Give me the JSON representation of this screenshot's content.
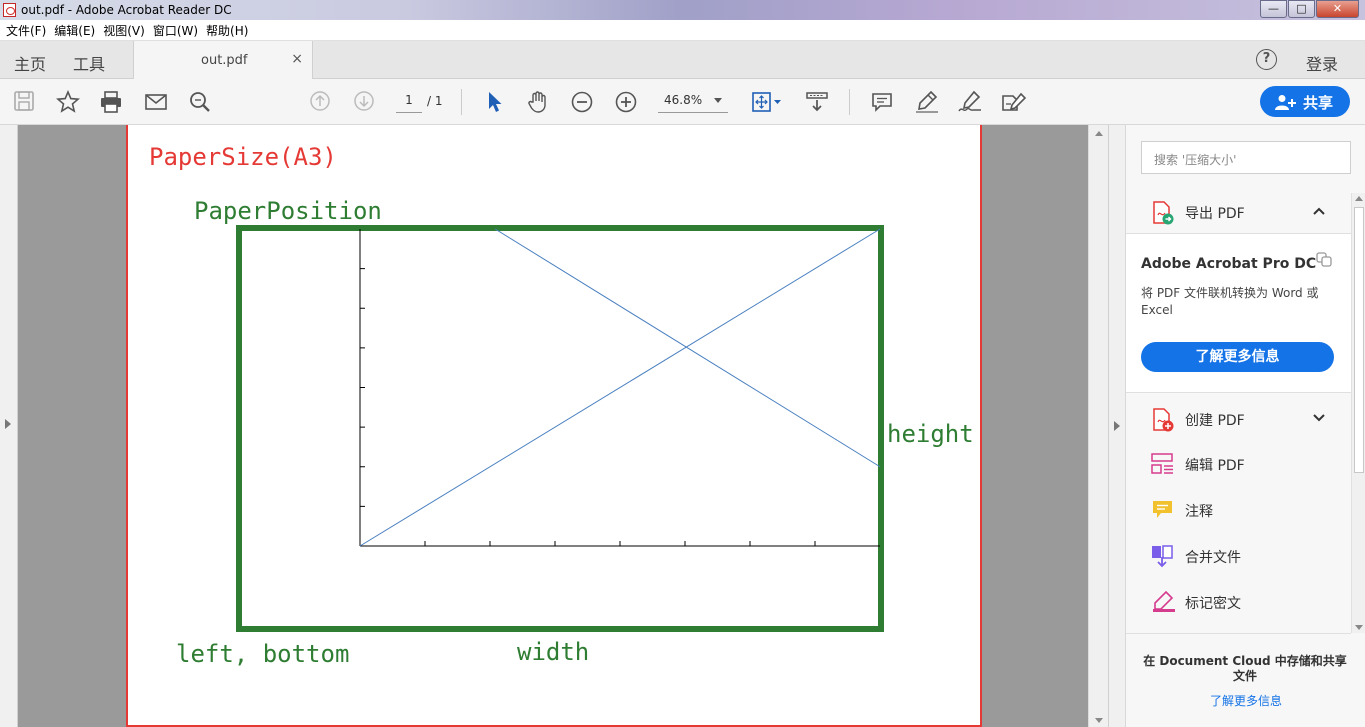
{
  "window": {
    "title": "out.pdf - Adobe Acrobat Reader DC",
    "minimize": "—",
    "maximize": "□",
    "close": "✕"
  },
  "menu": [
    "文件(F)",
    "编辑(E)",
    "视图(V)",
    "窗口(W)",
    "帮助(H)"
  ],
  "tabs": {
    "home": "主页",
    "tools": "工具",
    "document": "out.pdf",
    "close": "×"
  },
  "header_right": {
    "help": "?",
    "login": "登录"
  },
  "toolbar": {
    "page_current": "1",
    "page_total": "/ 1",
    "zoom": "46.8%",
    "share": "共享",
    "icons": [
      "save-icon",
      "star-icon",
      "print-icon",
      "mail-icon",
      "search-zoom-icon",
      "page-up-icon",
      "page-down-icon",
      "select-cursor-icon",
      "hand-icon",
      "zoom-out-icon",
      "zoom-in-icon",
      "fit-page-icon",
      "scroll-mode-icon",
      "comment-icon",
      "highlight-icon",
      "sign-icon",
      "fill-sign-icon"
    ]
  },
  "pdf": {
    "paper_size": "PaperSize(A3)",
    "paper_position": "PaperPosition",
    "height": "height",
    "left_bottom": "left, bottom",
    "width": "width",
    "colors": {
      "paper": "#e53935",
      "position": "#2e7d32",
      "line": "#4a80c0"
    },
    "chart_data": {
      "type": "line",
      "series": [
        {
          "x": [
            0,
            1
          ],
          "y": [
            0,
            1
          ]
        },
        {
          "x": [
            0.26,
            1
          ],
          "y": [
            1,
            0.25
          ]
        }
      ],
      "xlim": [
        0,
        1
      ],
      "ylim": [
        0,
        1
      ],
      "x_ticks": 8,
      "y_ticks": 8,
      "grid": false
    }
  },
  "right_panel": {
    "search_placeholder": "搜索 '压缩大小'",
    "export_pdf": "导出 PDF",
    "promo_title": "Adobe Acrobat Pro DC",
    "promo_desc": "将 PDF 文件联机转换为 Word 或 Excel",
    "promo_button": "了解更多信息",
    "tools": [
      "创建 PDF",
      "编辑 PDF",
      "注释",
      "合并文件",
      "标记密文"
    ],
    "cloud_text": "在 Document Cloud 中存储和共享文件",
    "cloud_link": "了解更多信息"
  }
}
